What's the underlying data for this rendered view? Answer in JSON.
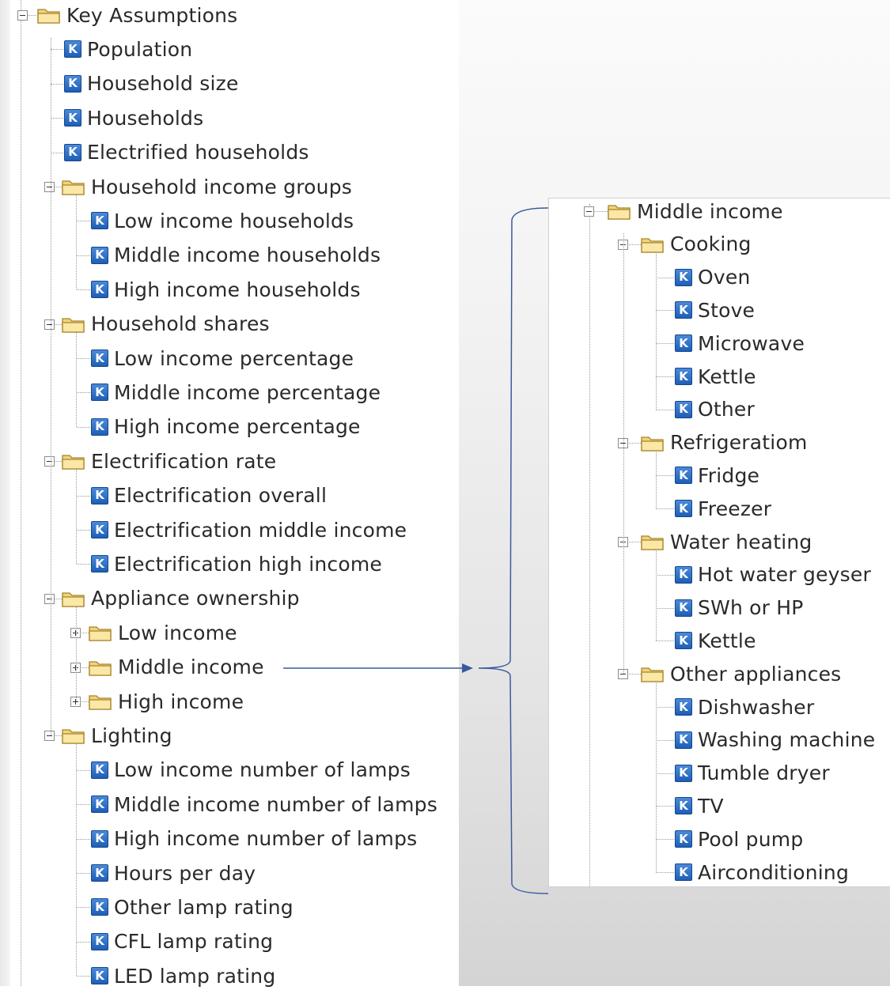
{
  "left_tree": {
    "root_label": "Key Assumptions",
    "items": [
      {
        "label": "Population"
      },
      {
        "label": "Household size"
      },
      {
        "label": "Households"
      },
      {
        "label": "Electrified households"
      }
    ],
    "folders": [
      {
        "label": "Household income groups",
        "expanded": true,
        "children": [
          "Low income households",
          "Middle income households",
          "High income households"
        ]
      },
      {
        "label": "Household shares",
        "expanded": true,
        "children": [
          "Low income percentage",
          "Middle income percentage",
          "High income percentage"
        ]
      },
      {
        "label": "Electrification rate",
        "expanded": true,
        "children": [
          "Electrification overall",
          "Electrification middle income",
          "Electrification high income"
        ]
      },
      {
        "label": "Appliance ownership",
        "expanded": true,
        "subfolders": [
          "Low income",
          "Middle income",
          "High income"
        ]
      },
      {
        "label": "Lighting",
        "expanded": true,
        "children": [
          "Low income number of lamps",
          "Middle income number of lamps",
          "High income number of lamps",
          "Hours per day",
          "Other lamp rating",
          "CFL lamp rating",
          "LED lamp rating"
        ]
      }
    ]
  },
  "right_tree": {
    "root_label": "Middle income",
    "folders": [
      {
        "label": "Cooking",
        "children": [
          "Oven",
          "Stove",
          "Microwave",
          "Kettle",
          "Other"
        ]
      },
      {
        "label": "Refrigeratiom",
        "children": [
          "Fridge",
          "Freezer"
        ]
      },
      {
        "label": "Water heating",
        "children": [
          "Hot water geyser",
          "SWh or HP",
          "Kettle"
        ]
      },
      {
        "label": "Other appliances",
        "children": [
          "Dishwasher",
          "Washing machine",
          "Tumble dryer",
          "TV",
          "Pool pump",
          "Airconditioning"
        ]
      }
    ]
  },
  "icons": {
    "key_icon_letter": "K",
    "folder_icon": "folder-icon",
    "key_icon": "key-assumption-icon"
  },
  "colors": {
    "key_icon": "#1e5fb6",
    "folder": "#f3d27a",
    "connector": "#3a5a9c",
    "text": "#2a2a2a"
  }
}
